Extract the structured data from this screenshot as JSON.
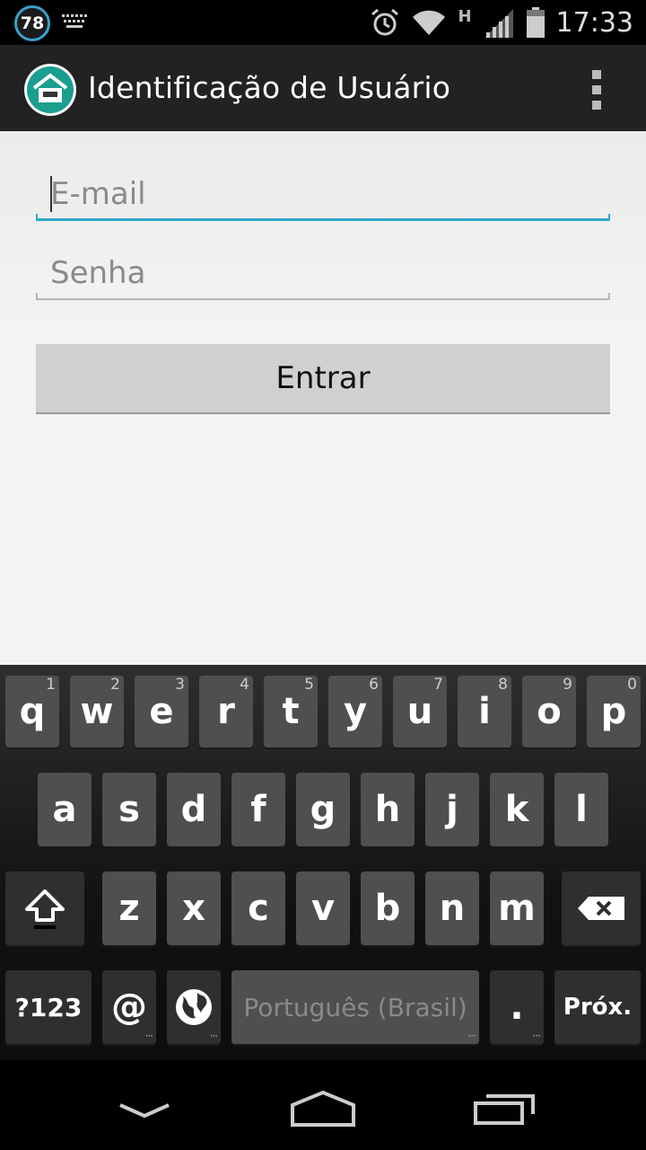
{
  "status_bar": {
    "notification_count": "78",
    "network_type": "H",
    "time": "17:33"
  },
  "action_bar": {
    "title": "Identificação de Usuário",
    "app_icon": "home-icon",
    "overflow_icon": "overflow-menu-icon"
  },
  "form": {
    "email_placeholder": "E-mail",
    "email_value": "",
    "password_placeholder": "Senha",
    "password_value": "",
    "submit_label": "Entrar"
  },
  "keyboard": {
    "row1": [
      {
        "label": "q",
        "hint": "1"
      },
      {
        "label": "w",
        "hint": "2"
      },
      {
        "label": "e",
        "hint": "3"
      },
      {
        "label": "r",
        "hint": "4"
      },
      {
        "label": "t",
        "hint": "5"
      },
      {
        "label": "y",
        "hint": "6"
      },
      {
        "label": "u",
        "hint": "7"
      },
      {
        "label": "i",
        "hint": "8"
      },
      {
        "label": "o",
        "hint": "9"
      },
      {
        "label": "p",
        "hint": "0"
      }
    ],
    "row2": [
      "a",
      "s",
      "d",
      "f",
      "g",
      "h",
      "j",
      "k",
      "l"
    ],
    "row3": [
      "z",
      "x",
      "c",
      "v",
      "b",
      "n",
      "m"
    ],
    "symbols_label": "?123",
    "at_label": "@",
    "space_label": "Português (Brasil)",
    "period_label": ".",
    "next_label": "Próx."
  },
  "colors": {
    "accent": "#33a6cf",
    "action_bar": "#222222",
    "app_icon": "#1a9e8f"
  }
}
